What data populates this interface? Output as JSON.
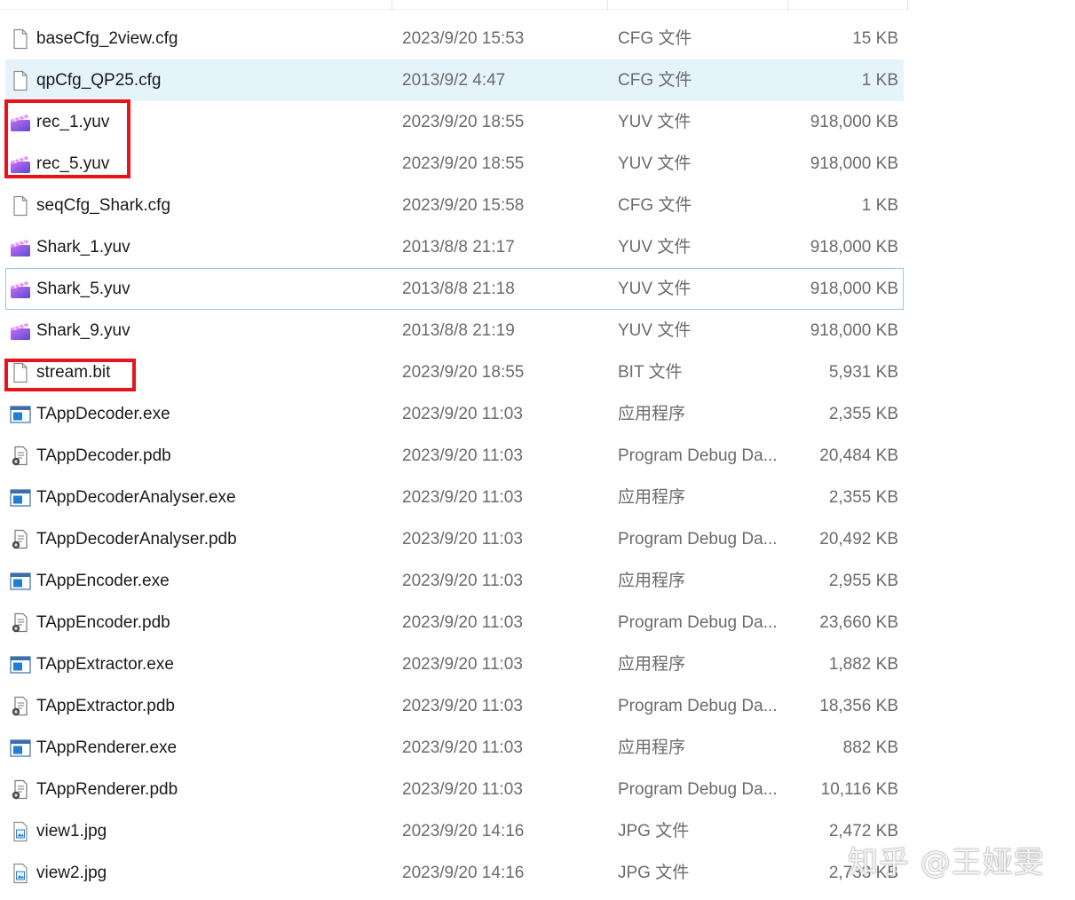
{
  "files": [
    {
      "name": "baseCfg_2view.cfg",
      "date": "2023/9/20 15:53",
      "type": "CFG 文件",
      "size": "15 KB",
      "icon": "file-icon"
    },
    {
      "name": "qpCfg_QP25.cfg",
      "date": "2013/9/2 4:47",
      "type": "CFG 文件",
      "size": "1 KB",
      "icon": "file-icon",
      "selected": true
    },
    {
      "name": "rec_1.yuv",
      "date": "2023/9/20 18:55",
      "type": "YUV 文件",
      "size": "918,000 KB",
      "icon": "video-clapper-icon"
    },
    {
      "name": "rec_5.yuv",
      "date": "2023/9/20 18:55",
      "type": "YUV 文件",
      "size": "918,000 KB",
      "icon": "video-clapper-icon"
    },
    {
      "name": "seqCfg_Shark.cfg",
      "date": "2023/9/20 15:58",
      "type": "CFG 文件",
      "size": "1 KB",
      "icon": "file-icon"
    },
    {
      "name": "Shark_1.yuv",
      "date": "2013/8/8 21:17",
      "type": "YUV 文件",
      "size": "918,000 KB",
      "icon": "video-clapper-icon"
    },
    {
      "name": "Shark_5.yuv",
      "date": "2013/8/8 21:18",
      "type": "YUV 文件",
      "size": "918,000 KB",
      "icon": "video-clapper-icon",
      "focused": true
    },
    {
      "name": "Shark_9.yuv",
      "date": "2013/8/8 21:19",
      "type": "YUV 文件",
      "size": "918,000 KB",
      "icon": "video-clapper-icon"
    },
    {
      "name": "stream.bit",
      "date": "2023/9/20 18:55",
      "type": "BIT 文件",
      "size": "5,931 KB",
      "icon": "file-icon"
    },
    {
      "name": "TAppDecoder.exe",
      "date": "2023/9/20 11:03",
      "type": "应用程序",
      "size": "2,355 KB",
      "icon": "exe-icon"
    },
    {
      "name": "TAppDecoder.pdb",
      "date": "2023/9/20 11:03",
      "type": "Program Debug Da...",
      "size": "20,484 KB",
      "icon": "pdb-icon"
    },
    {
      "name": "TAppDecoderAnalyser.exe",
      "date": "2023/9/20 11:03",
      "type": "应用程序",
      "size": "2,355 KB",
      "icon": "exe-icon"
    },
    {
      "name": "TAppDecoderAnalyser.pdb",
      "date": "2023/9/20 11:03",
      "type": "Program Debug Da...",
      "size": "20,492 KB",
      "icon": "pdb-icon"
    },
    {
      "name": "TAppEncoder.exe",
      "date": "2023/9/20 11:03",
      "type": "应用程序",
      "size": "2,955 KB",
      "icon": "exe-icon"
    },
    {
      "name": "TAppEncoder.pdb",
      "date": "2023/9/20 11:03",
      "type": "Program Debug Da...",
      "size": "23,660 KB",
      "icon": "pdb-icon"
    },
    {
      "name": "TAppExtractor.exe",
      "date": "2023/9/20 11:03",
      "type": "应用程序",
      "size": "1,882 KB",
      "icon": "exe-icon"
    },
    {
      "name": "TAppExtractor.pdb",
      "date": "2023/9/20 11:03",
      "type": "Program Debug Da...",
      "size": "18,356 KB",
      "icon": "pdb-icon"
    },
    {
      "name": "TAppRenderer.exe",
      "date": "2023/9/20 11:03",
      "type": "应用程序",
      "size": "882 KB",
      "icon": "exe-icon"
    },
    {
      "name": "TAppRenderer.pdb",
      "date": "2023/9/20 11:03",
      "type": "Program Debug Da...",
      "size": "10,116 KB",
      "icon": "pdb-icon"
    },
    {
      "name": "view1.jpg",
      "date": "2023/9/20 14:16",
      "type": "JPG 文件",
      "size": "2,472 KB",
      "icon": "image-file-icon"
    },
    {
      "name": "view2.jpg",
      "date": "2023/9/20 14:16",
      "type": "JPG 文件",
      "size": "2,733 KB",
      "icon": "image-file-icon"
    }
  ],
  "annotation_color": "#e8141b",
  "selection_color": "#e5f3fb",
  "watermark": "知乎 @王娅雯"
}
